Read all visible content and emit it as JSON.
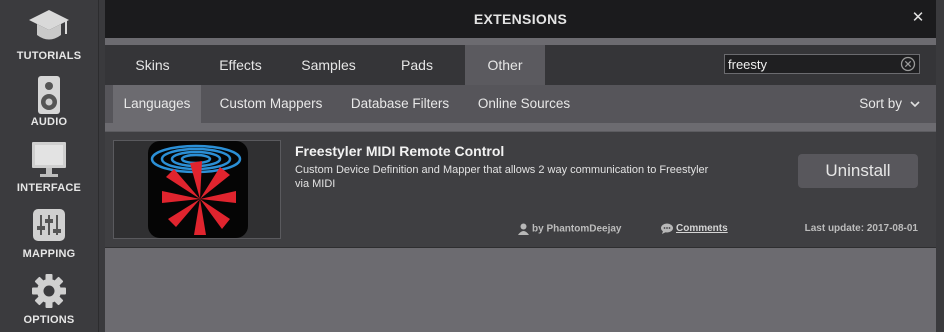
{
  "sidebar": {
    "items": [
      {
        "label": "TUTORIALS",
        "icon": "graduation-cap-icon"
      },
      {
        "label": "AUDIO",
        "icon": "speaker-icon"
      },
      {
        "label": "INTERFACE",
        "icon": "monitor-icon"
      },
      {
        "label": "MAPPING",
        "icon": "sliders-icon"
      },
      {
        "label": "OPTIONS",
        "icon": "gear-icon"
      }
    ]
  },
  "window": {
    "title": "EXTENSIONS",
    "close_glyph": "✕"
  },
  "tabs": [
    {
      "label": "Skins"
    },
    {
      "label": "Effects"
    },
    {
      "label": "Samples"
    },
    {
      "label": "Pads"
    },
    {
      "label": "Other",
      "active": true
    }
  ],
  "search": {
    "value": "freesty",
    "clear_icon": "clear-circle-icon"
  },
  "subtabs": [
    {
      "label": "Languages",
      "active": true
    },
    {
      "label": "Custom Mappers"
    },
    {
      "label": "Database Filters"
    },
    {
      "label": "Online Sources"
    }
  ],
  "sort": {
    "label": "Sort by",
    "icon": "chevron-down-icon"
  },
  "extension": {
    "name": "Freestyler MIDI Remote Control",
    "description": "Custom Device Definition and Mapper that allows 2 way communication to Freestyler via MIDI",
    "action_label": "Uninstall",
    "author": "by PhantomDeejay",
    "comments_label": "Comments",
    "last_update": "Last update: 2017-08-01"
  },
  "colors": {
    "titlebar": "#1b1b1d",
    "accent_red": "#e0242e",
    "logo_blue": "#2b8fd6"
  }
}
